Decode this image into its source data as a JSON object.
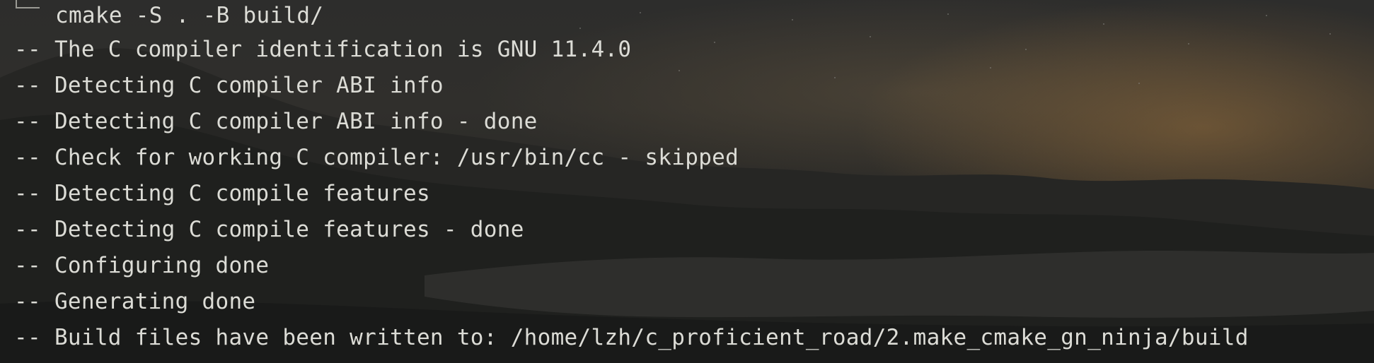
{
  "terminal": {
    "command": "cmake -S . -B build/",
    "output_prefix": "--",
    "output": [
      "The C compiler identification is GNU 11.4.0",
      "Detecting C compiler ABI info",
      "Detecting C compiler ABI info - done",
      "Check for working C compiler: /usr/bin/cc - skipped",
      "Detecting C compile features",
      "Detecting C compile features - done",
      "Configuring done",
      "Generating done",
      "Build files have been written to: /home/lzh/c_proficient_road/2.make_cmake_gn_ninja/build"
    ]
  },
  "colors": {
    "text": "#dcdcd6",
    "background": "#2d2d2c",
    "glow": "#96703c"
  }
}
